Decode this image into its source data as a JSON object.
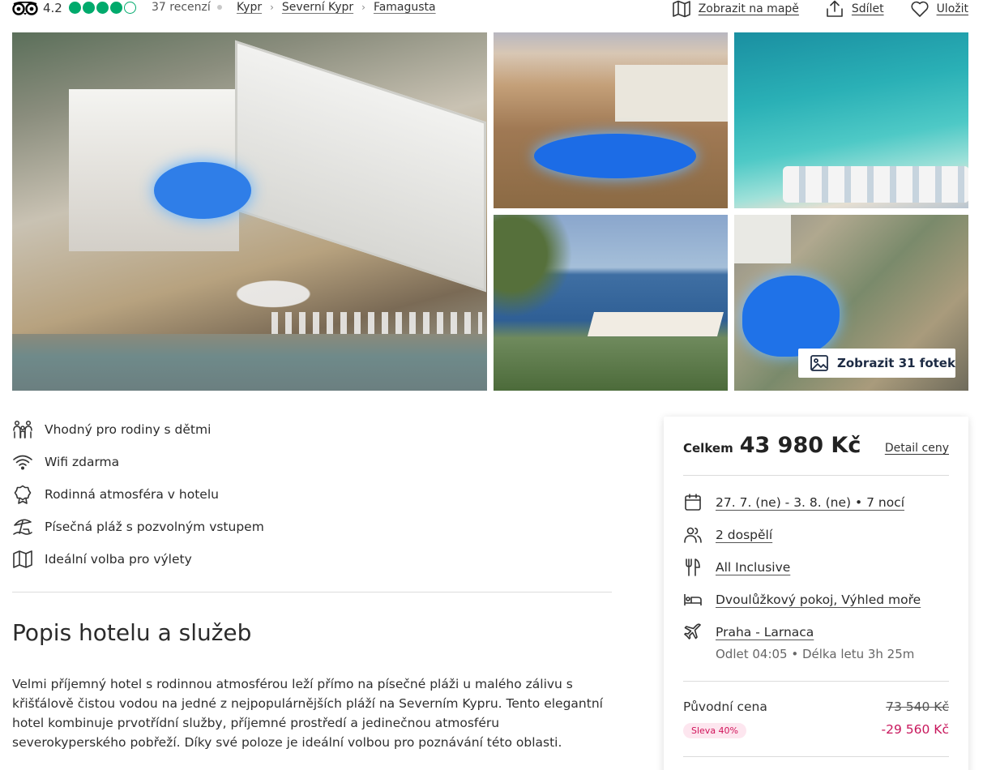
{
  "rating": {
    "value": "4.2",
    "bubbles_filled": 4,
    "bubbles_total": 5,
    "reviews": "37 recenzí",
    "accent": "#00aa6c"
  },
  "breadcrumb": [
    "Kypr",
    "Severní Kypr",
    "Famagusta"
  ],
  "actions": {
    "map": "Zobrazit na mapě",
    "share": "Sdílet",
    "save": "Uložit"
  },
  "gallery": {
    "show_photos": "Zobrazit 31 fotek"
  },
  "features": [
    {
      "icon": "family-icon",
      "label": "Vhodný pro rodiny s dětmi"
    },
    {
      "icon": "wifi-icon",
      "label": "Wifi zdarma"
    },
    {
      "icon": "award-icon",
      "label": "Rodinná atmosféra v hotelu"
    },
    {
      "icon": "beach-icon",
      "label": "Písečná pláž s pozvolným vstupem"
    },
    {
      "icon": "map-icon",
      "label": "Ideální volba pro výlety"
    }
  ],
  "section": {
    "title": "Popis hotelu a služeb",
    "description": "Velmi příjemný hotel s rodinnou atmosférou leží přímo na písečné pláži u malého zálivu s křišťálově čistou vodou na jedné z nejpopulárnějších pláží na Severním Kypru. Tento elegantní hotel kombinuje prvotřídní služby, příjemné prostředí a jedinečnou atmosféru severokyperského pobřeží. Díky své poloze je ideální volbou pro poznávání této oblasti."
  },
  "card": {
    "total_label": "Celkem",
    "total_price": "43 980 Kč",
    "detail_link": "Detail ceny",
    "dates": "27. 7. (ne) - 3. 8. (ne) • 7 nocí",
    "guests": "2 dospělí",
    "board": "All Inclusive",
    "room": "Dvoulůžkový pokoj, Výhled moře",
    "flight": "Praha - Larnaca",
    "flight_info": "Odlet 04:05 • Délka letu 3h 25m",
    "original_label": "Původní cena",
    "original_price": "73 540 Kč",
    "discount_badge": "Sleva 40%",
    "discount_amount": "-29 560 Kč",
    "discount_color": "#c8175c"
  }
}
